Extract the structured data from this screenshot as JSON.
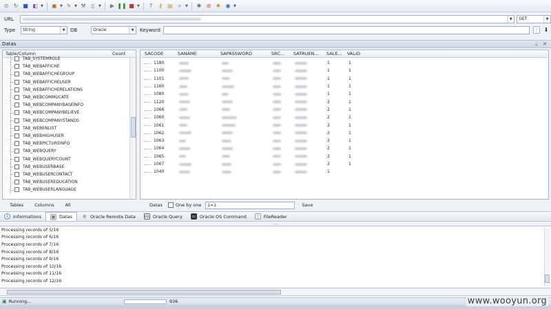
{
  "url": {
    "label": "URL",
    "method": "GET"
  },
  "options": {
    "type_label": "Type",
    "type_value": "String",
    "db_label": "DB",
    "db_value": "Oracle",
    "keyword_label": "Keyword",
    "keyword_value": ""
  },
  "panel": {
    "title": "Datas"
  },
  "tree": {
    "headers": [
      "Table/Column",
      "Count"
    ],
    "items": [
      "TAB_SYSTEMROLE",
      "TAB_WEBAFFICHE",
      "TAB_WEBAFFICHEGROUP",
      "TAB_WEBAFFICHEUSER",
      "TAB_WEBAFFICHERELATIONS",
      "TAB_WEBCOMMUCATE",
      "TAB_WEBCOMPANYBASEINFO",
      "TAB_WEBCOMPANYBELIEVE",
      "TAB_WEBCOMPANYSTANDS",
      "TAB_WEBENLIST",
      "TAB_WEBHIGHUSER",
      "TAB_WEBPICTUREINFO",
      "TAB_WEBQUERY",
      "TAB_WEBQUERYCOUNT",
      "TAB_WEBUSERBASE",
      "TAB_WEBUSERCONTACT",
      "TAB_WEBUSEREDUCATION",
      "TAB_WEBUSERLANGUAGE"
    ],
    "footer": [
      "Tables",
      "Columns",
      "All"
    ]
  },
  "grid": {
    "headers": [
      "SACODE",
      "SANAME",
      "SAPASSWORD",
      "SRC...",
      "SATRUEN...",
      "SALE...",
      "VALID"
    ],
    "rows": [
      [
        "1180",
        "1",
        "1"
      ],
      [
        "1100",
        "1",
        "1"
      ],
      [
        "1101",
        "1",
        "1"
      ],
      [
        "1160",
        "1",
        "1"
      ],
      [
        "1080",
        "1",
        "1"
      ],
      [
        "1120",
        "2",
        "1"
      ],
      [
        "1066",
        "2",
        "1"
      ],
      [
        "1060",
        "2",
        "1"
      ],
      [
        "1061",
        "2",
        "1"
      ],
      [
        "1062",
        "2",
        "1"
      ],
      [
        "1063",
        "2",
        "1"
      ],
      [
        "1064",
        "2",
        "1"
      ],
      [
        "1065",
        "2",
        "1"
      ],
      [
        "1067",
        "2",
        "1"
      ],
      [
        "1040",
        "1",
        ""
      ]
    ]
  },
  "data_bar": {
    "datas": "Datas",
    "one_by_one": "One by one",
    "range": "1=1",
    "save": "Save"
  },
  "tabs": [
    "Informations",
    "Datas",
    "Oracle Remote Data",
    "Oracle Query",
    "Oracle OS Command",
    "FileReader"
  ],
  "log": [
    "Processing records of 5/16",
    "Processing records of 6/16",
    "Processing records of 7/16",
    "Processing records of 8/16",
    "Processing records of 9/16",
    "Processing records of 10/16",
    "Processing records of 11/16",
    "Processing records of 12/16"
  ],
  "status": {
    "text": "Running...",
    "count": "936"
  },
  "watermark": "www.wooyun.org"
}
